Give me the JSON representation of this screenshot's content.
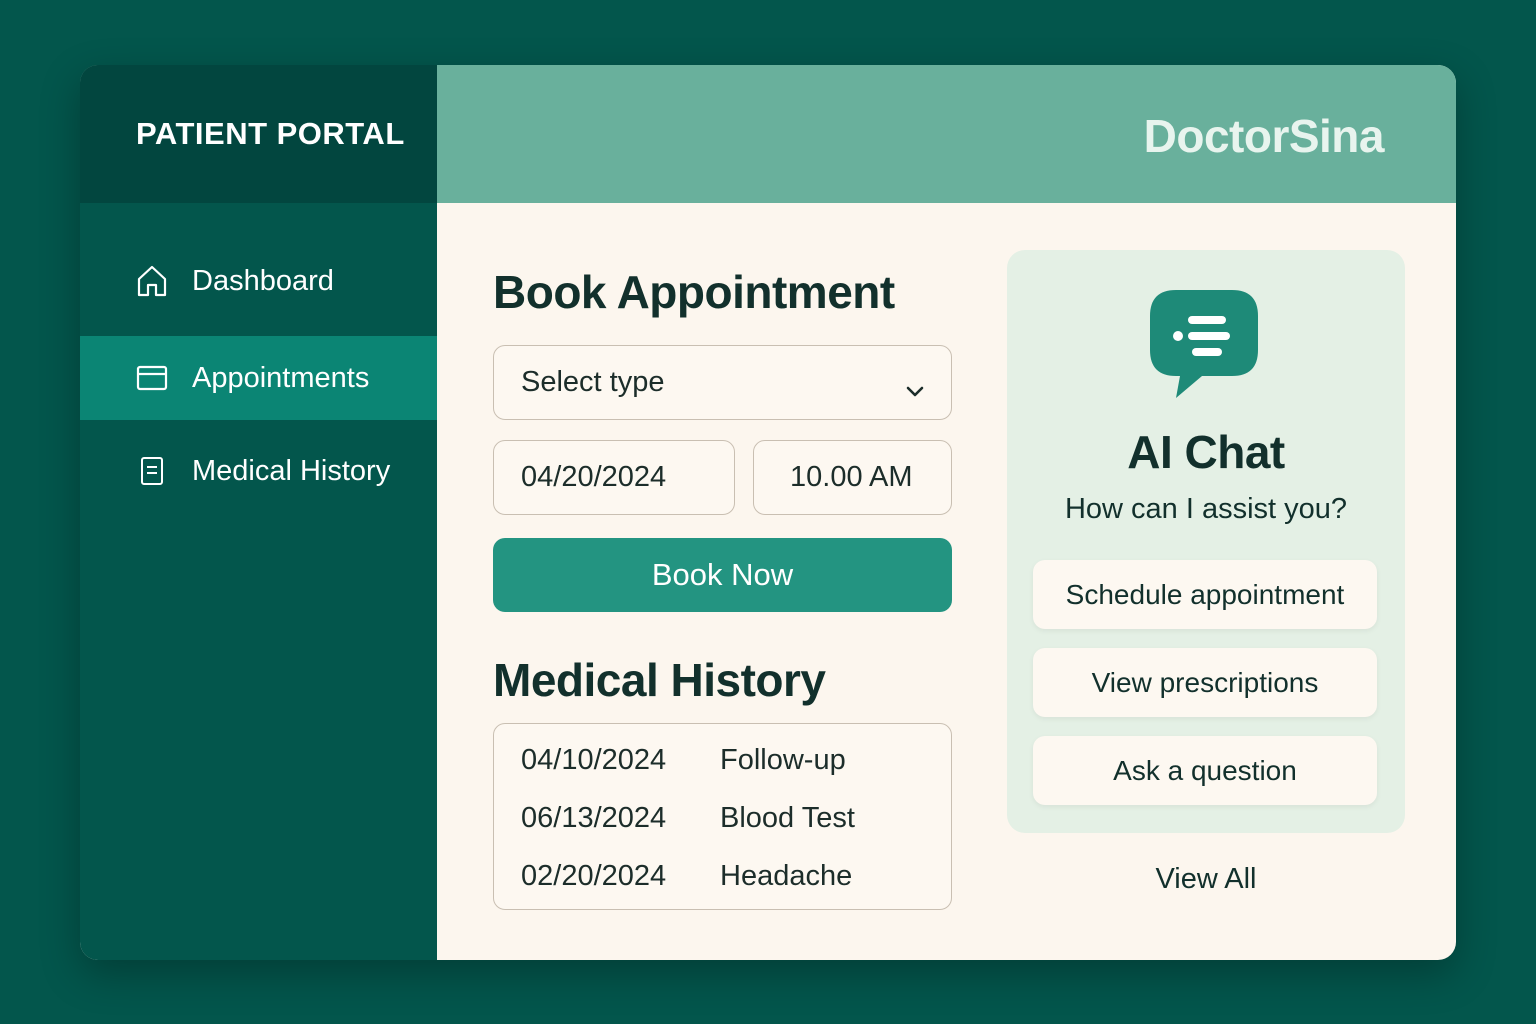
{
  "sidebar": {
    "title": "PATIENT PORTAL",
    "items": [
      {
        "label": "Dashboard",
        "icon": "home-icon",
        "active": false
      },
      {
        "label": "Appointments",
        "icon": "card-icon",
        "active": true
      },
      {
        "label": "Medical History",
        "icon": "document-icon",
        "active": false
      }
    ]
  },
  "header": {
    "brand": "DoctorSina"
  },
  "booking": {
    "title": "Book Appointment",
    "type_select": "Select type",
    "date": "04/20/2024",
    "time": "10.00 AM",
    "submit_label": "Book Now"
  },
  "history": {
    "title": "Medical History",
    "rows": [
      {
        "date": "04/10/2024",
        "description": "Follow-up"
      },
      {
        "date": "06/13/2024",
        "description": "Blood Test"
      },
      {
        "date": "02/20/2024",
        "description": "Headache"
      }
    ]
  },
  "chat": {
    "icon": "chat-bubble-icon",
    "title": "AI Chat",
    "subtitle": "How can I assist you?",
    "options": [
      "Schedule appointment",
      "View prescriptions",
      "Ask a question"
    ],
    "view_all": "View All"
  },
  "colors": {
    "background": "#03564c",
    "sidebar_header": "#02463f",
    "sidebar_active": "#0b8574",
    "topbar": "#69b09c",
    "content": "#fcf6ee",
    "primary_button": "#239481",
    "chat_card": "#e4f0e5",
    "chat_icon": "#1e8a78"
  }
}
